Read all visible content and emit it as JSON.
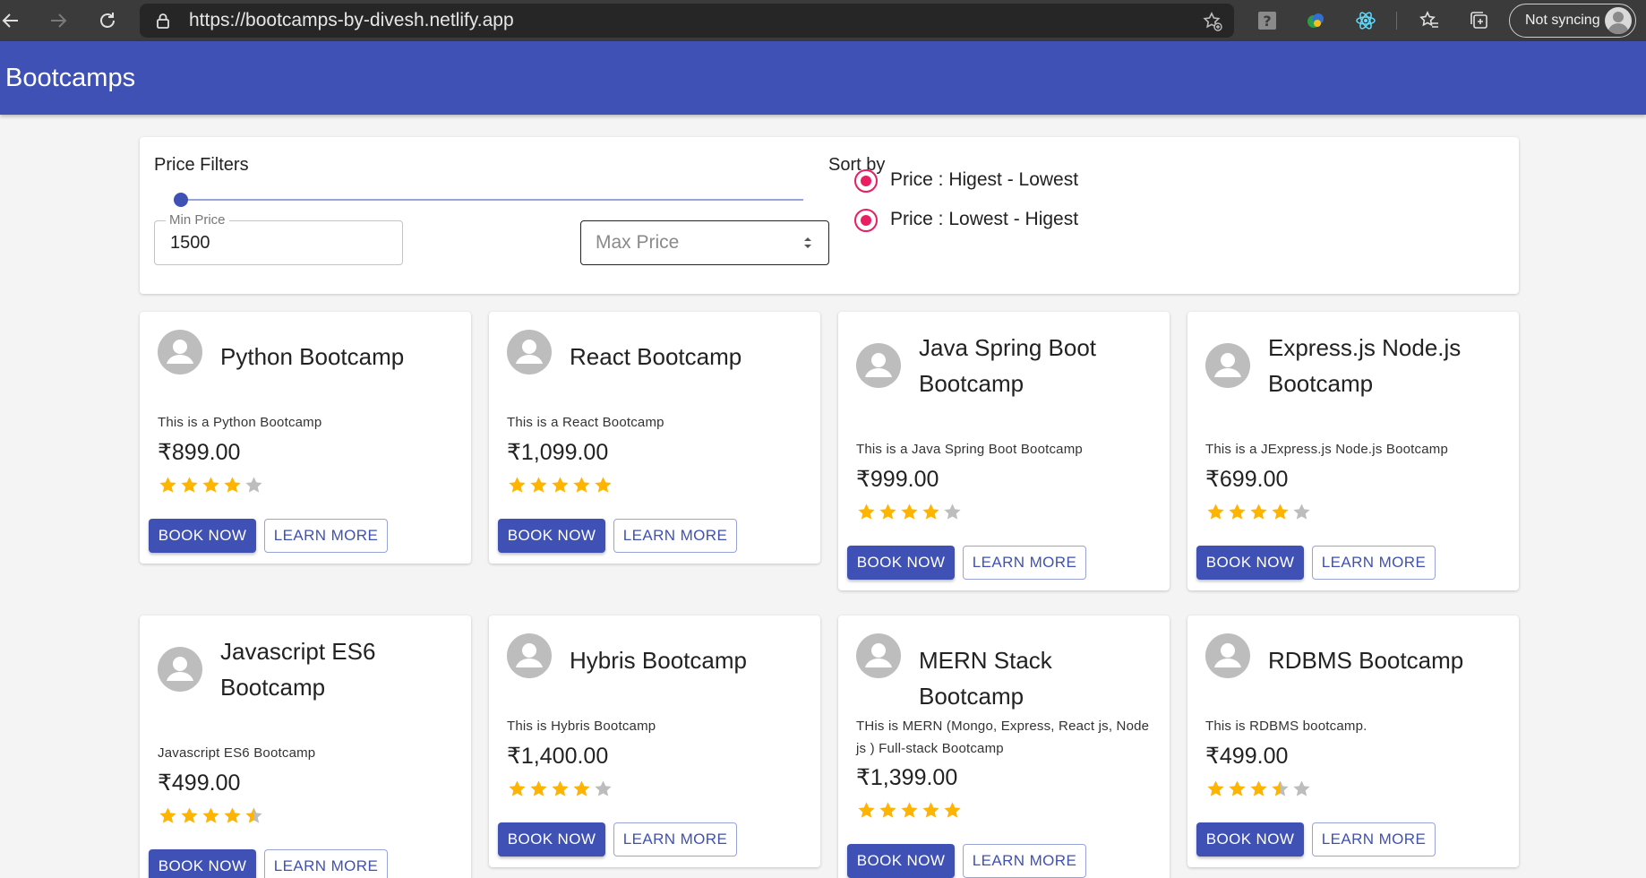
{
  "browser": {
    "url": "https://bootcamps-by-divesh.netlify.app",
    "sync_label": "Not syncing"
  },
  "app": {
    "title": "Bootcamps"
  },
  "filters": {
    "title": "Price Filters",
    "slider_value_fraction": 0.0,
    "min_price_label": "Min Price",
    "min_price_value": "1500",
    "max_price_placeholder": "Max Price",
    "sort_title": "Sort by",
    "sort_options": [
      {
        "label": "Price : Higest - Lowest",
        "selected": true
      },
      {
        "label": "Price : Lowest - Higest",
        "selected": true
      }
    ]
  },
  "accent_color": "#3f51b5",
  "radio_color": "#e91e63",
  "star_color": "#ffb400",
  "buttons": {
    "book": "BOOK NOW",
    "learn": "LEARN MORE"
  },
  "bootcamps": [
    {
      "title": "Python Bootcamp",
      "description": "This is a Python Bootcamp",
      "price": "₹899.00",
      "rating": 4
    },
    {
      "title": "React Bootcamp",
      "description": "This is a React Bootcamp",
      "price": "₹1,099.00",
      "rating": 5
    },
    {
      "title": "Java Spring Boot Bootcamp",
      "description": "This is a Java Spring Boot Bootcamp",
      "price": "₹999.00",
      "rating": 4
    },
    {
      "title": "Express.js Node.js Bootcamp",
      "description": "This is a JExpress.js Node.js Bootcamp",
      "price": "₹699.00",
      "rating": 4
    },
    {
      "title": "Javascript ES6 Bootcamp",
      "description": "Javascript ES6 Bootcamp",
      "price": "₹499.00",
      "rating": 4.5
    },
    {
      "title": "Hybris Bootcamp",
      "description": "This is Hybris Bootcamp",
      "price": "₹1,400.00",
      "rating": 4
    },
    {
      "title": "MERN Stack Bootcamp",
      "description": "THis is MERN (Mongo, Express, React js, Node js ) Full-stack Bootcamp",
      "price": "₹1,399.00",
      "rating": 5
    },
    {
      "title": "RDBMS Bootcamp",
      "description": "This is RDBMS bootcamp.",
      "price": "₹499.00",
      "rating": 3.5
    }
  ]
}
